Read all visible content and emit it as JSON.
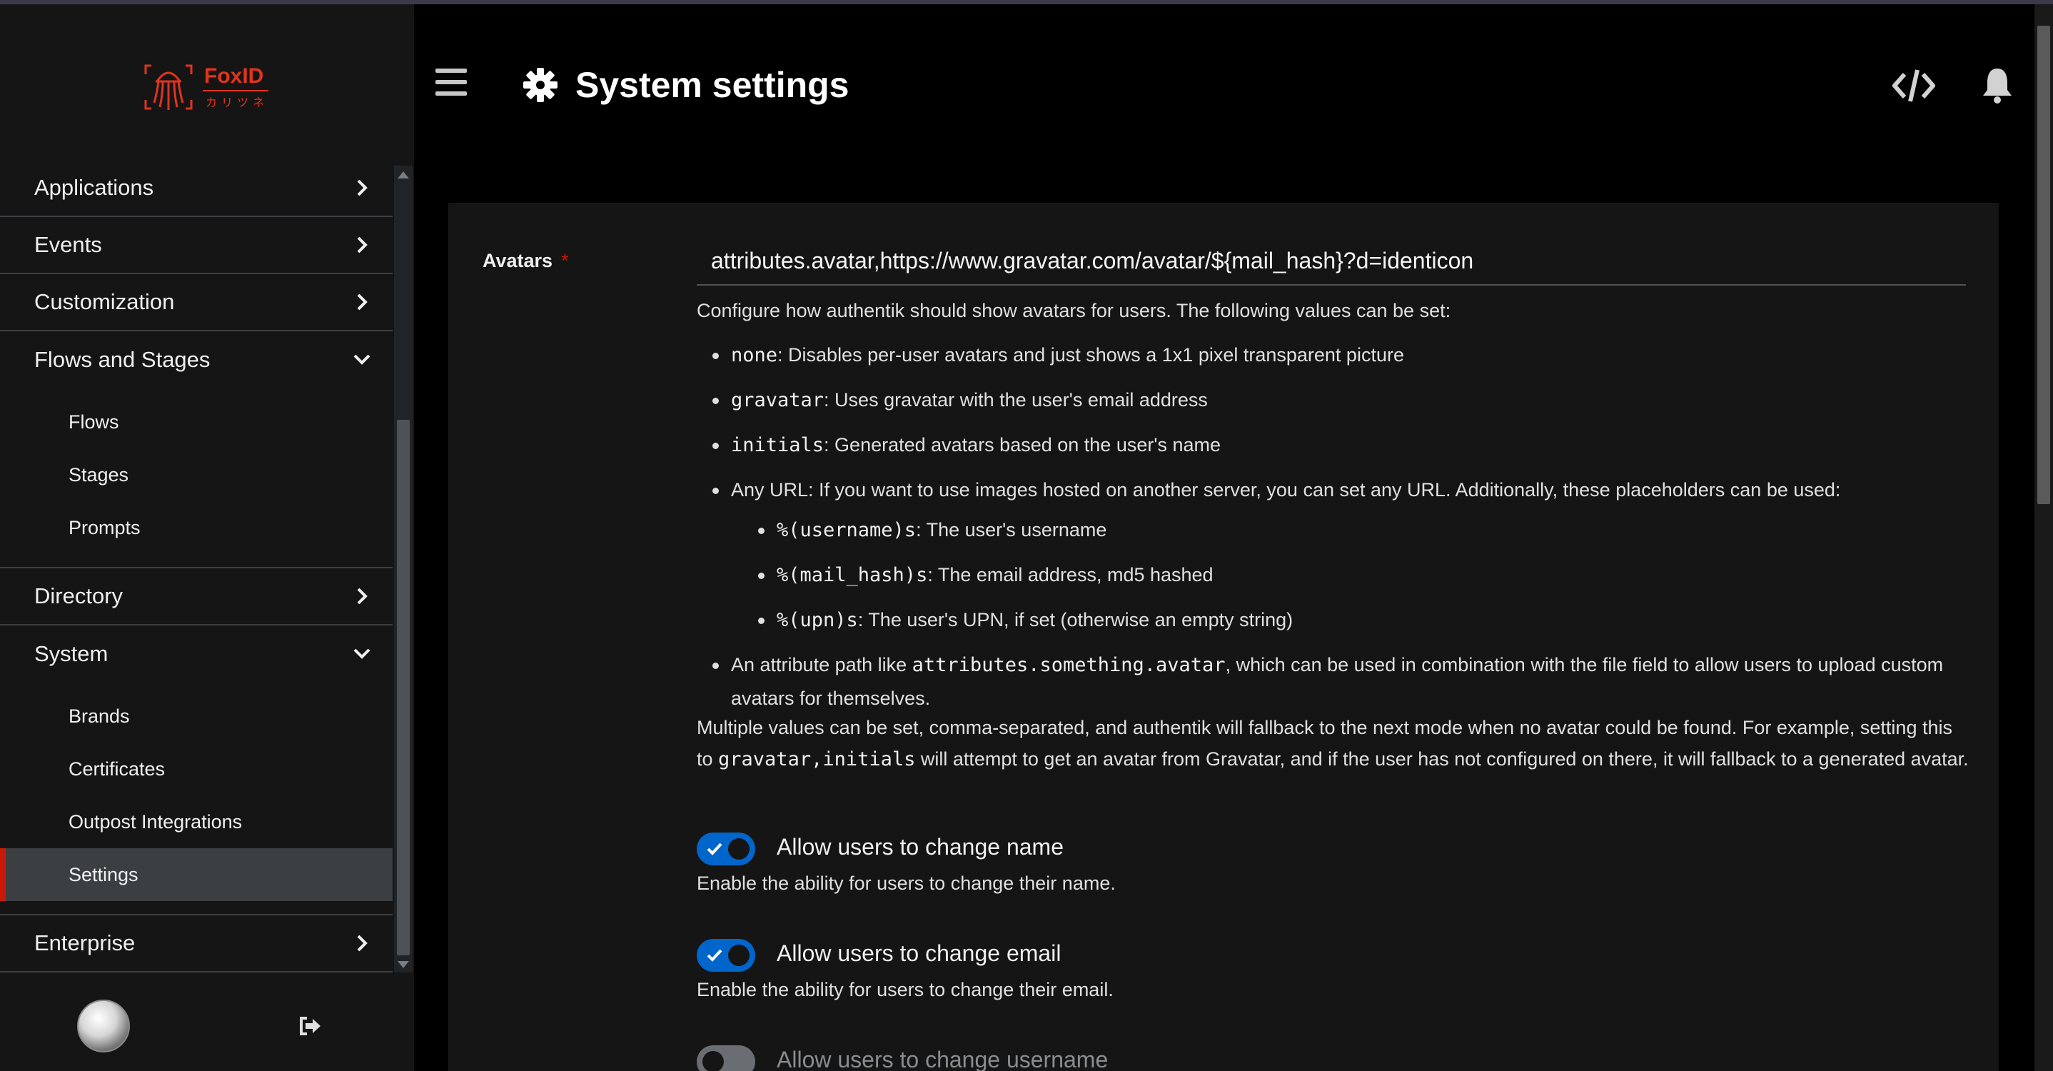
{
  "brand": {
    "name": "FoxID",
    "subtitle": "カリツネ",
    "color": "#e1341e"
  },
  "header": {
    "title": "System settings",
    "icons": [
      "menu-icon",
      "gear-icon",
      "code-icon",
      "bell-icon"
    ]
  },
  "sidebar": {
    "items": [
      {
        "label": "Applications",
        "expanded": false
      },
      {
        "label": "Events",
        "expanded": false
      },
      {
        "label": "Customization",
        "expanded": false
      },
      {
        "label": "Flows and Stages",
        "expanded": true,
        "children": [
          "Flows",
          "Stages",
          "Prompts"
        ]
      },
      {
        "label": "Directory",
        "expanded": false
      },
      {
        "label": "System",
        "expanded": true,
        "children": [
          "Brands",
          "Certificates",
          "Outpost Integrations",
          "Settings"
        ],
        "active_child": "Settings"
      },
      {
        "label": "Enterprise",
        "expanded": false
      }
    ],
    "accent": "#c9190b"
  },
  "form": {
    "avatars": {
      "label": "Avatars",
      "required_mark": "*",
      "value": "attributes.avatar,https://www.gravatar.com/avatar/${mail_hash}?d=identicon",
      "help_intro": "Configure how authentik should show avatars for users. The following values can be set:",
      "opt_none_code": "none",
      "opt_none_text": ": Disables per-user avatars and just shows a 1x1 pixel transparent picture",
      "opt_gravatar_code": "gravatar",
      "opt_gravatar_text": ": Uses gravatar with the user's email address",
      "opt_initials_code": "initials",
      "opt_initials_text": ": Generated avatars based on the user's name",
      "opt_url_text": "Any URL: If you want to use images hosted on another server, you can set any URL. Additionally, these placeholders can be used:",
      "ph_username_code": "%(username)s",
      "ph_username_text": ": The user's username",
      "ph_mail_code": "%(mail_hash)s",
      "ph_mail_text": ": The email address, md5 hashed",
      "ph_upn_code": "%(upn)s",
      "ph_upn_text": ": The user's UPN, if set (otherwise an empty string)",
      "opt_attr_pre": "An attribute path like ",
      "opt_attr_code": "attributes.something.avatar",
      "opt_attr_post": ", which can be used in combination with the file field to allow users to upload custom avatars for themselves.",
      "multi_pre": "Multiple values can be set, comma-separated, and authentik will fallback to the next mode when no avatar could be found. For example, setting this to ",
      "multi_code": "gravatar,initials",
      "multi_post": " will attempt to get an avatar from Gravatar, and if the user has not configured on there, it will fallback to a generated avatar."
    },
    "toggles": [
      {
        "label": "Allow users to change name",
        "help": "Enable the ability for users to change their name.",
        "on": true
      },
      {
        "label": "Allow users to change email",
        "help": "Enable the ability for users to change their email.",
        "on": true
      },
      {
        "label": "Allow users to change username",
        "help": "",
        "on": false
      }
    ]
  },
  "colors": {
    "switch_on": "#0066cc",
    "switch_off": "#6a6e73",
    "card_bg": "#151515",
    "page_bg": "#000000"
  }
}
